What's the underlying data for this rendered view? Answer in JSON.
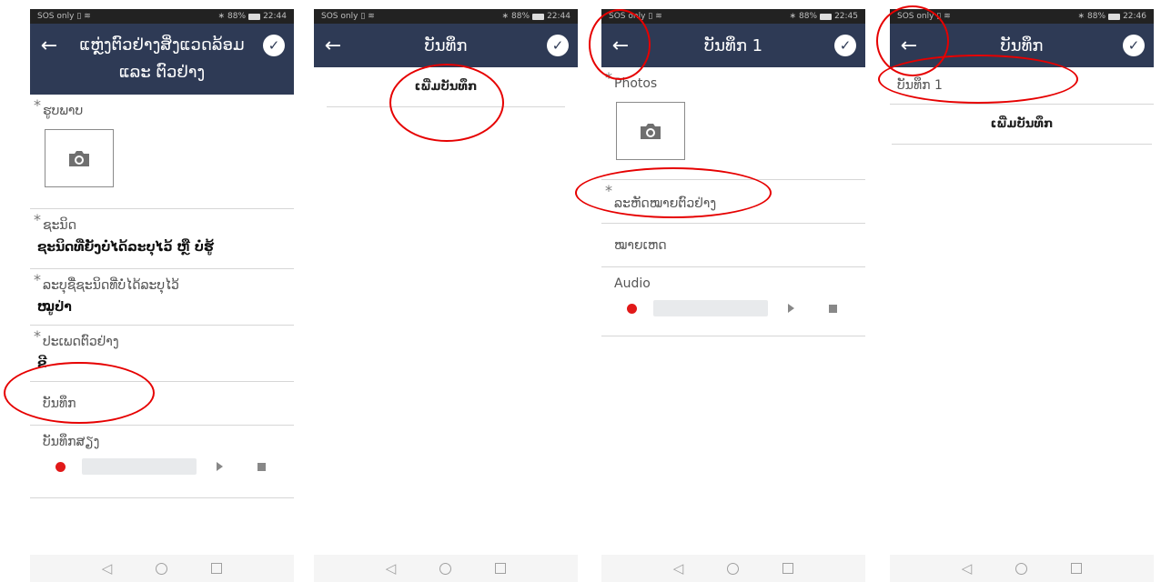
{
  "status": {
    "left": "SOS only",
    "s1_right": "88%",
    "s1_time": "22:44",
    "s2_time": "22:44",
    "s3_time": "22:45",
    "s4_time": "22:46"
  },
  "screen1": {
    "title_line1": "ແຫຼ່ງຕົວຢ່າງສິ່ງແວດລ້ອມ",
    "title_line2": "ແລະ ຕົວຢ່າງ",
    "photo_label": "ຮູບພາບ",
    "species_label": "ຊະນິດ",
    "species_value": "ຊະນິດທີ່ຍັງບໍ່ໄດ້ລະບຸໄວ້ ຫຼື ບໍ່ຮູ້",
    "unidentified_label": "ລະບຸຊື່ຊະນິດທີ່ບໍ່ໄດ້ລະບຸໄວ້",
    "unidentified_value": "ໝູປ່າ",
    "sample_type_label": "ປະເພດຕົວຢ່າງ",
    "sample_type_value": "ຂີ",
    "notes_label": "ບັນທຶກ",
    "audio_label": "ບັນທຶກສຽງ"
  },
  "screen2": {
    "title": "ບັນທຶກ",
    "add_entry": "ເພີ່ມບັນທຶກ"
  },
  "screen3": {
    "title": "ບັນທຶກ 1",
    "photos_label": "Photos",
    "sample_code_label": "ລະຫັດໝາຍຕົວຢ່າງ",
    "remark_label": "ໝາຍເຫດ",
    "audio_label": "Audio"
  },
  "screen4": {
    "title": "ບັນທຶກ",
    "entry1": "ບັນທຶກ 1",
    "add_entry": "ເພີ່ມບັນທຶກ"
  },
  "colors": {
    "appbar": "#2e3a55",
    "annotation": "#e60000",
    "record": "#e11919"
  },
  "icons": [
    "back-arrow-icon",
    "check-icon",
    "camera-icon",
    "record-icon",
    "play-icon",
    "stop-icon",
    "nav-back-icon",
    "nav-home-icon",
    "nav-recents-icon"
  ]
}
